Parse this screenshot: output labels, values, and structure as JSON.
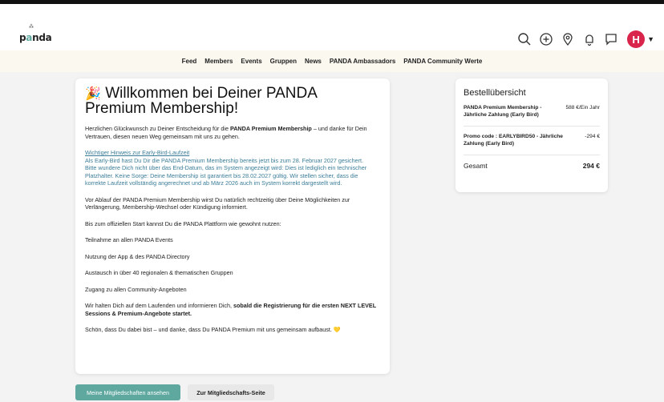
{
  "brand": {
    "logo_text": "panda",
    "logo_accent": "#5fa8a0"
  },
  "header_icons": [
    "search-icon",
    "plus-circle-icon",
    "location-pin-icon",
    "bell-icon",
    "chat-icon"
  ],
  "user": {
    "initial": "H",
    "color": "#d9254c"
  },
  "nav": [
    "Feed",
    "Members",
    "Events",
    "Gruppen",
    "News",
    "PANDA Ambassadors",
    "PANDA Community Werte"
  ],
  "content": {
    "title": "Willkommen bei Deiner PANDA Premium Membership!",
    "intro_pre": "Herzlichen Glückwunsch zu Deiner Entscheidung für die ",
    "intro_bold": "PANDA Premium Membership",
    "intro_post": " – und danke für Dein Vertrauen, diesen neuen Weg gemeinsam mit uns zu gehen.",
    "hint_title": "Wichtiger Hinweis zur Early-Bird-Laufzeit",
    "hint_line1": "Als Early-Bird hast Du Dir die PANDA Premium Membership bereits jetzt bis zum 28. Februar 2027 gesichert.",
    "hint_line2": "Bitte wundere Dich nicht über das End-Datum, das im System angezeigt wird: Dies ist lediglich ein technischer Platzhalter. Keine Sorge: Deine Membership ist garantiert bis 28.02.2027 gültig. Wir stellen sicher, dass die korrekte Laufzeit vollständig angerechnet und ab März 2026 auch im System korrekt dargestellt wird.",
    "p_renewal": "Vor Ablauf der PANDA Premium Membership wirst Du natürlich rechtzeitig über Deine Möglichkeiten zur Verlängerung, Membership-Wechsel oder Kündigung informiert.",
    "p_until": "Bis zum offiziellen Start kannst Du die PANDA Plattform wie gewohnt nutzen:",
    "features": [
      "Teilnahme an allen PANDA Events",
      "Nutzung der App & des PANDA Directory",
      "Austausch in über 40 regionalen & thematischen Gruppen",
      "Zugang zu allen Community-Angeboten"
    ],
    "p_info_pre": "Wir halten Dich auf dem Laufenden und informieren Dich, ",
    "p_info_bold": "sobald die Registrierung für die ersten NEXT LEVEL Sessions & Premium-Angebote startet.",
    "p_thanks": "Schön, dass Du dabei bist – und danke, dass Du PANDA Premium mit uns gemeinsam aufbaust. 💛"
  },
  "order": {
    "title": "Bestellübersicht",
    "items": [
      {
        "label": "PANDA Premium Membership - Jährliche Zahlung (Early Bird)",
        "price": "588 €/Ein Jahr"
      },
      {
        "label": "Promo code : EARLYBIRD50 - Jährliche Zahlung (Early Bird)",
        "price": "-294 €"
      }
    ],
    "total_label": "Gesamt",
    "total_value": "294 €"
  },
  "buttons": {
    "memberships": "Meine Mitgliedschaften ansehen",
    "membership_page": "Zur Mitgliedschafts-Seite"
  }
}
